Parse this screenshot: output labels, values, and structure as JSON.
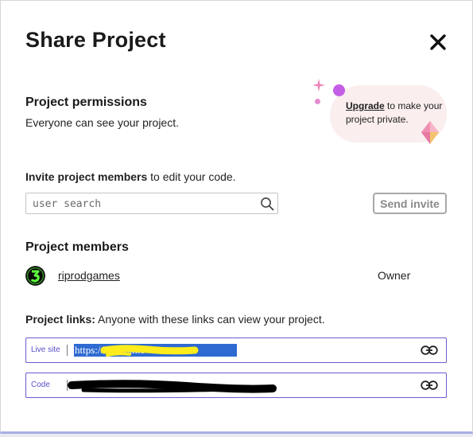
{
  "dialog": {
    "title": "Share Project"
  },
  "permissions": {
    "heading": "Project permissions",
    "description": "Everyone can see your project.",
    "upgrade_link": "Upgrade",
    "upgrade_text": " to make your project private."
  },
  "invite": {
    "label_bold": "Invite project members",
    "label_rest": " to edit your code.",
    "search_placeholder": "user search",
    "send_button": "Send invite"
  },
  "members": {
    "heading": "Project members",
    "list": [
      {
        "name": "riprodgames",
        "role": "Owner"
      }
    ]
  },
  "links": {
    "label_bold": "Project links:",
    "label_rest": " Anyone with these links can view your project.",
    "items": [
      {
        "label": "Live site",
        "url": "https://                                glitch.me"
      },
      {
        "label": "Code",
        "url": ""
      }
    ]
  },
  "icons": {
    "close": "close-icon",
    "search": "search-icon",
    "link": "link-icon",
    "sparkle": "sparkle-icon",
    "gem": "gem-icon"
  },
  "colors": {
    "accent": "#6b5bd0",
    "bubble": "#fbeeee",
    "highlight": "#2e6ad1",
    "redaction_yellow": "#ffec1a",
    "redaction_black": "#000000"
  }
}
